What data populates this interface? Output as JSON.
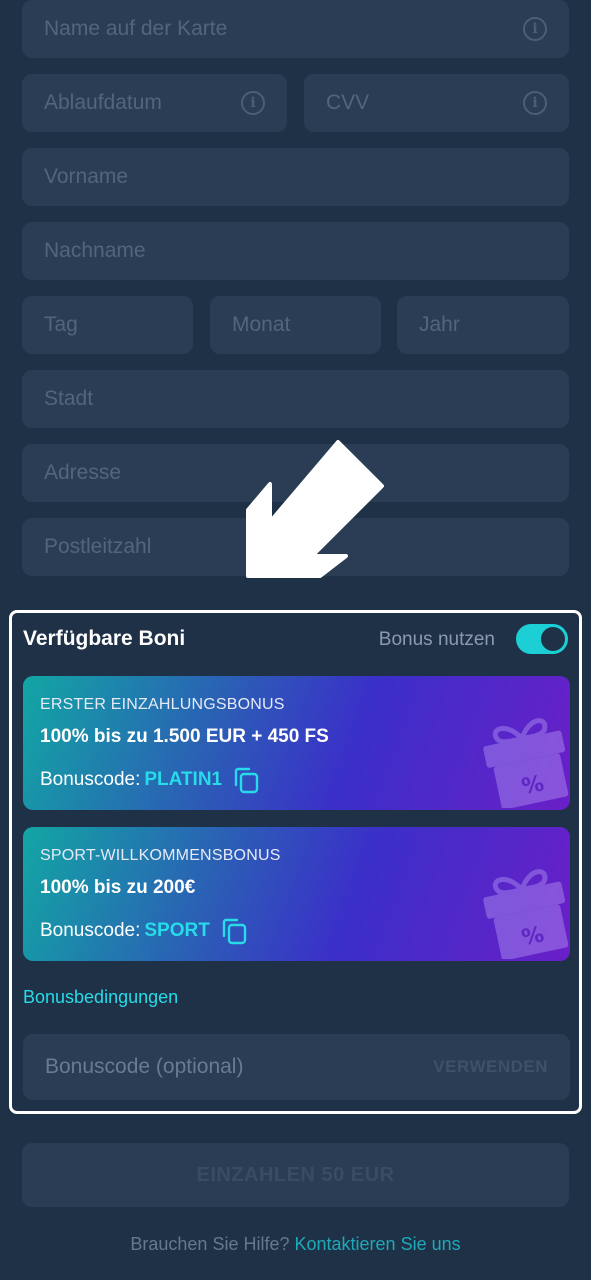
{
  "form": {
    "card_name": "Name auf der Karte",
    "expiry": "Ablaufdatum",
    "cvv": "CVV",
    "first_name": "Vorname",
    "last_name": "Nachname",
    "day": "Tag",
    "month": "Monat",
    "year": "Jahr",
    "city": "Stadt",
    "address": "Adresse",
    "postal_code": "Postleitzahl"
  },
  "bonus": {
    "title": "Verfügbare Boni",
    "toggle_label": "Bonus nutzen",
    "toggle_on": true,
    "code_prefix": "Bonuscode:",
    "cards": [
      {
        "label": "ERSTER EINZAHLUNGSBONUS",
        "offer": "100% bis zu 1.500 EUR + 450 FS",
        "code": "PLATIN1"
      },
      {
        "label": "SPORT-WILLKOMMENSBONUS",
        "offer": "100% bis zu 200€",
        "code": "SPORT"
      }
    ],
    "terms_link": "Bonusbedingungen",
    "code_input_placeholder": "Bonuscode (optional)",
    "apply_label": "VERWENDEN"
  },
  "deposit_button": "EINZAHLEN 50 EUR",
  "help": {
    "text": "Brauchen Sie Hilfe?",
    "link": "Kontaktieren Sie uns"
  },
  "colors": {
    "background": "#1f3147",
    "field": "#2a3d55",
    "accent": "#27dbe8",
    "toggle": "#1ccfd4"
  }
}
